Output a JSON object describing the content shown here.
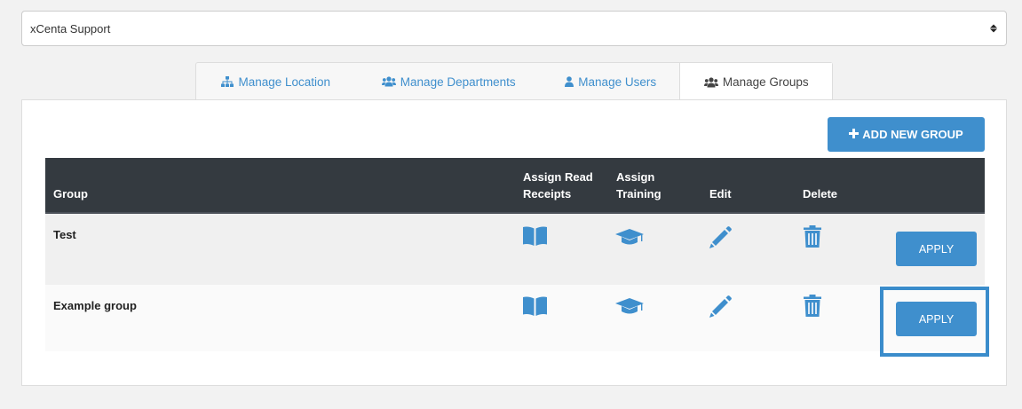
{
  "org_select": {
    "value": "xCenta Support"
  },
  "tabs": [
    {
      "label": "Manage Location",
      "icon": "sitemap-icon"
    },
    {
      "label": "Manage Departments",
      "icon": "users-icon"
    },
    {
      "label": "Manage Users",
      "icon": "user-icon"
    },
    {
      "label": "Manage Groups",
      "icon": "users-icon",
      "active": true
    }
  ],
  "add_button": {
    "label": "ADD NEW GROUP",
    "icon": "plus-icon"
  },
  "table": {
    "headers": {
      "group": "Group",
      "read_receipts_1": "Assign Read",
      "read_receipts_2": "Receipts",
      "training_1": "Assign",
      "training_2": "Training",
      "edit": "Edit",
      "delete": "Delete"
    },
    "rows": [
      {
        "name": "Test",
        "apply_label": "APPLY"
      },
      {
        "name": "Example group",
        "apply_label": "APPLY"
      }
    ]
  },
  "colors": {
    "accent": "#3f8fcd",
    "header_bg": "#343a40",
    "highlight": "#3a8ccb"
  }
}
